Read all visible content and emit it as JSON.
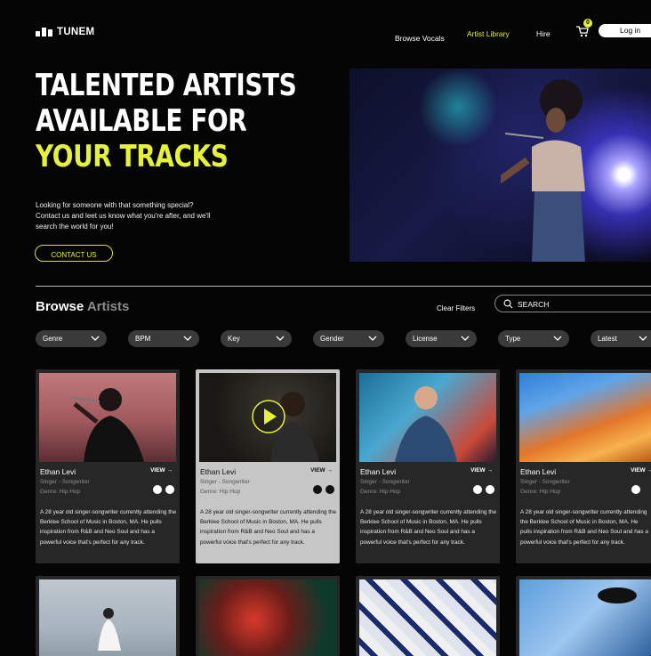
{
  "header": {
    "logo_text": "TUNEM",
    "nav": [
      "Browse Vocals",
      "Artist Library",
      "Hire"
    ],
    "cart_count": "0",
    "login_label": "Log in",
    "accent": "#e5f13a"
  },
  "hero": {
    "line1": "TALENTED ARTISTS",
    "line2": "AVAILABLE FOR",
    "line3": "YOUR TRACKS",
    "desc": "Looking for someone with that something special? Contact us and leet us know what you're after, and we'll search the world for you!",
    "contact_label": "CONTACT US"
  },
  "browse": {
    "title_a": "Browse",
    "title_b": "Artists",
    "clear_label": "Clear Filters",
    "search_placeholder": "SEARCH",
    "filters": [
      "Genre",
      "BPM",
      "Key",
      "Gender",
      "License",
      "Type",
      "Latest"
    ]
  },
  "cards": [
    {
      "name": "Ethan Levi",
      "view": "VIEW",
      "role": "Singer - Songwriter",
      "genre": "Genre: Hip Hop",
      "desc": "A 28 year old singer-songwriter currently attending the Berklee School of Music in Boston, MA. He pulls inspiration from R&B and Neo Soul and has a powerful voice that's perfect for any track."
    },
    {
      "name": "Ethan Levi",
      "view": "VIEW",
      "role": "Singer - Songwriter",
      "genre": "Genre: Hip Hop",
      "desc": "A 28 year old singer-songwriter currently attending the Berklee School of Music in Boston, MA. He pulls inspiration from R&B and Neo Soul and has a powerful voice that's perfect for any track."
    },
    {
      "name": "Ethan Levi",
      "view": "VIEW",
      "role": "Singer - Songwriter",
      "genre": "Genre: Hip Hop",
      "desc": "A 28 year old singer-songwriter currently attending the Berklee School of Music in Boston, MA. He pulls inspiration from R&B and Neo Soul and has a powerful voice that's perfect for any track."
    },
    {
      "name": "Ethan Levi",
      "view": "VIEW",
      "role": "Singer - Songwriter",
      "genre": "Genre: Hip Hop",
      "desc": "A 28 year old singer-songwriter currently attending the Berklee School of Music in Boston, MA. He pulls inspiration from R&B and Neo Soul and has a powerful voice that's perfect for any track."
    }
  ],
  "icons": [
    "cart-icon",
    "search-icon",
    "chevron-down-icon",
    "play-icon",
    "heart-icon",
    "add-icon",
    "arrow-right-icon"
  ]
}
